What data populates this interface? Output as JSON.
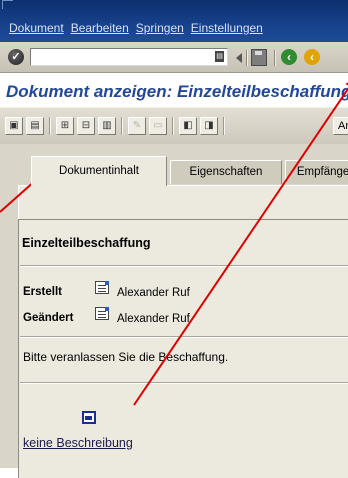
{
  "menubar": {
    "items": [
      "Dokument",
      "Bearbeiten",
      "Springen",
      "Einstellungen"
    ]
  },
  "system_toolbar": {
    "command_value": "",
    "icons": [
      "enter-icon",
      "dropdown-icon",
      "back-triangle-icon",
      "save-icon",
      "back-icon",
      "exit-icon"
    ]
  },
  "title": "Dokument anzeigen: Einzelteilbeschaffung",
  "app_toolbar": {
    "text_button_label": "An"
  },
  "tabs": [
    {
      "label": "Dokumentinhalt",
      "active": true
    },
    {
      "label": "Eigenschaften",
      "active": false
    },
    {
      "label": "Empfänger",
      "active": false
    }
  ],
  "document": {
    "heading": "Einzelteilbeschaffung",
    "created_label": "Erstellt",
    "created_by": "Alexander Ruf",
    "changed_label": "Geändert",
    "changed_by": "Alexander Ruf",
    "message": "Bitte veranlassen Sie die Beschaffung.",
    "description_link": "keine Beschreibung"
  },
  "colors": {
    "menubar_bg": "#16408a",
    "title_text": "#23489a",
    "annotation_arrow": "#e00000",
    "panel_bg": "#ece9df"
  }
}
